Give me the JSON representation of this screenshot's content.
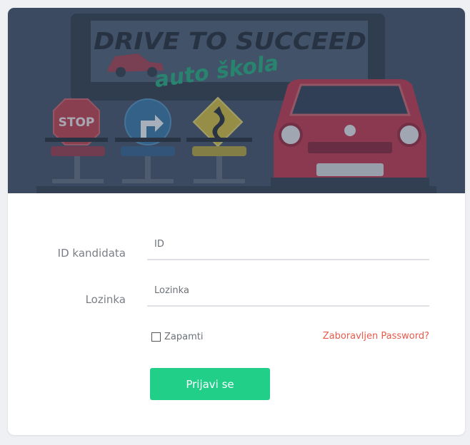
{
  "banner": {
    "title_text": "DRIVE TO SUCCEED",
    "subtitle_text": "auto škola",
    "stop_sign_text": "STOP",
    "colors": {
      "overlay": "#3b4b60",
      "title": "#1d2633",
      "subtitle": "#1fa377",
      "car_red": "#b43048",
      "stop_red": "#b23a48",
      "blue_sign": "#2f6e9c",
      "yellow_sign": "#c6b33a"
    }
  },
  "form": {
    "id_label": "ID kandidata",
    "id_placeholder": "ID",
    "password_label": "Lozinka",
    "password_placeholder": "Lozinka",
    "remember_label": "Zapamti",
    "remember_checked": false,
    "forgot_link": "Zaboravljen Password?",
    "submit_label": "Prijavi se"
  },
  "colors": {
    "accent_button": "#22cf89",
    "link": "#e85a4a"
  }
}
